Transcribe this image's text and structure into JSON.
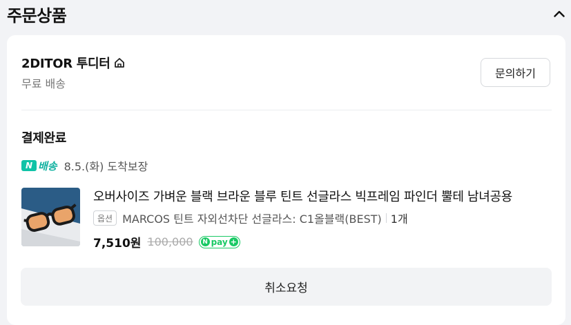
{
  "section": {
    "title": "주문상품",
    "collapse_icon": "chevron-up-icon"
  },
  "seller": {
    "name": "2DITOR 투디터",
    "home_icon": "home-icon",
    "shipping": "무료 배송",
    "inquiry_label": "문의하기"
  },
  "order": {
    "status": "결제완료",
    "delivery_badge_n": "N",
    "delivery_badge_label": "배송",
    "delivery_text": "8.5.(화) 도착보장"
  },
  "product": {
    "name": "오버사이즈 가벼운 블랙 브라운 블루 틴트 선글라스 빅프레임 파인더 뿔테 남녀공용",
    "option_tag": "옵션",
    "option_text": "MARCOS 틴트 자외선차단 선글라스: C1올블랙(BEST)",
    "quantity": "1개",
    "price": "7,510원",
    "original_price": "100,000",
    "npay_n": "N",
    "npay_label": "pay",
    "npay_plus": "+"
  },
  "actions": {
    "cancel_label": "취소요청"
  },
  "colors": {
    "background": "#f2f3f6",
    "card": "#ffffff",
    "npay_green": "#18c964",
    "delivery_teal": "#10c3a7"
  }
}
